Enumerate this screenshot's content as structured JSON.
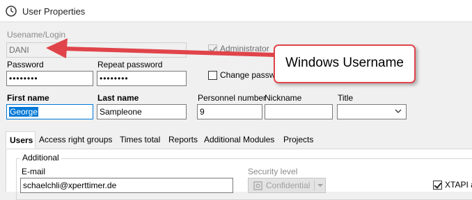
{
  "window": {
    "title": "User Properties",
    "icon": "clock-icon"
  },
  "login": {
    "label": "Usename/Login",
    "value": "DANI"
  },
  "administrator": {
    "label": "Administrator",
    "checked": true
  },
  "change_password": {
    "label": "Change passw",
    "checked": false
  },
  "password": {
    "label": "Password",
    "value": "••••••••"
  },
  "repeat_password": {
    "label": "Repeat password",
    "value": "••••••••"
  },
  "first_name": {
    "label": "First name",
    "value": "George"
  },
  "last_name": {
    "label": "Last name",
    "value": "Sampleone"
  },
  "personnel_number": {
    "label": "Personnel number",
    "value": "9"
  },
  "nickname": {
    "label": "Nickname",
    "value": ""
  },
  "title_field": {
    "label": "Title",
    "value": ""
  },
  "tabs": [
    {
      "label": "Users",
      "active": true
    },
    {
      "label": "Access right groups"
    },
    {
      "label": "Times total"
    },
    {
      "label": "Reports"
    },
    {
      "label": "Additional Modules"
    },
    {
      "label": "Projects"
    }
  ],
  "additional": {
    "group_label": "Additional",
    "email_label": "E-mail",
    "email_value": "schaelchli@xperttimer.de",
    "security_label": "Security level",
    "security_value": "Confidential",
    "xtapi_label": "XTAPI ac"
  },
  "annotation": {
    "callout_text": "Windows Username",
    "color": "#e0444a"
  }
}
